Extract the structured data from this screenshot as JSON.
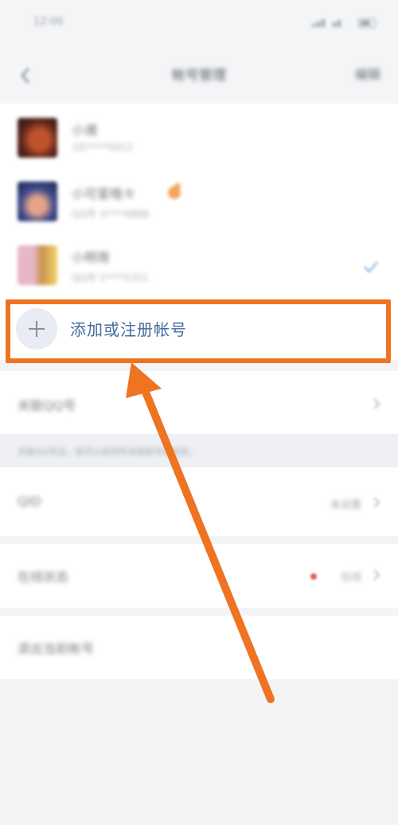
{
  "status_bar": {
    "time": "12:00"
  },
  "nav": {
    "title": "帐号管理",
    "action": "编辑"
  },
  "accounts": [
    {
      "name": "小湘",
      "subtitle": "187****0012"
    },
    {
      "name": "小可爱哦々",
      "subtitle": "QQ号 3****6888"
    },
    {
      "name": "小明哥",
      "subtitle": "QQ号 2****5321"
    }
  ],
  "add_account": {
    "label": "添加或注册帐号"
  },
  "settings": {
    "related_accounts": "关联QQ号",
    "note": "关联QQ号后，就可以收到所关联账号的消息。",
    "qid_label": "QID",
    "qid_value": "未设置",
    "status_label": "在线状态",
    "status_value": "在线",
    "logout": "退出当前帐号"
  },
  "colors": {
    "highlight": "#ee7422",
    "add_text": "#436b9a",
    "arrow": "#ee7422"
  }
}
